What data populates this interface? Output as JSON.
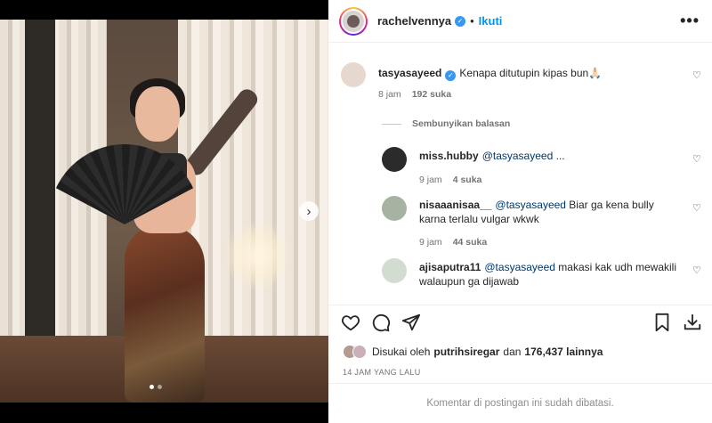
{
  "post": {
    "username": "rachelvennya",
    "follow_label": "Ikuti",
    "separator": "•",
    "more_label": "•••"
  },
  "comments": [
    {
      "user": "tasyasayeed",
      "verified": true,
      "text": "Kenapa ditutupin kipas bun🙏🏻",
      "time": "8 jam",
      "likes": "192 suka"
    },
    {
      "user": "miss.hubby",
      "mention": "@tasyasayeed",
      "text": " ...",
      "time": "9 jam",
      "likes": "4 suka"
    },
    {
      "user": "nisaaanisaa__",
      "mention": "@tasyasayeed",
      "text": " Biar ga kena bully karna terlalu vulgar wkwk",
      "time": "9 jam",
      "likes": "44 suka"
    },
    {
      "user": "ajisaputra11",
      "mention": "@tasyasayeed",
      "text": " makasi kak udh mewakili walaupun ga dijawab"
    }
  ],
  "hide_replies_label": "Sembunyikan balasan",
  "liked": {
    "prefix": "Disukai oleh",
    "user": "putrihsiregar",
    "middle": "dan",
    "count": "176,437 lainnya"
  },
  "time_ago": "14 JAM YANG LALU",
  "comments_disabled": "Komentar di postingan ini sudah dibatasi.",
  "carousel": {
    "slides": 2,
    "active": 1
  },
  "icons": {
    "like": "heart-icon",
    "comment": "comment-icon",
    "share": "share-icon",
    "save": "bookmark-icon",
    "download": "download-icon",
    "next": "chevron-right-icon"
  },
  "colors": {
    "link": "#0095f6",
    "mention": "#00376b",
    "verified": "#3897f0"
  }
}
